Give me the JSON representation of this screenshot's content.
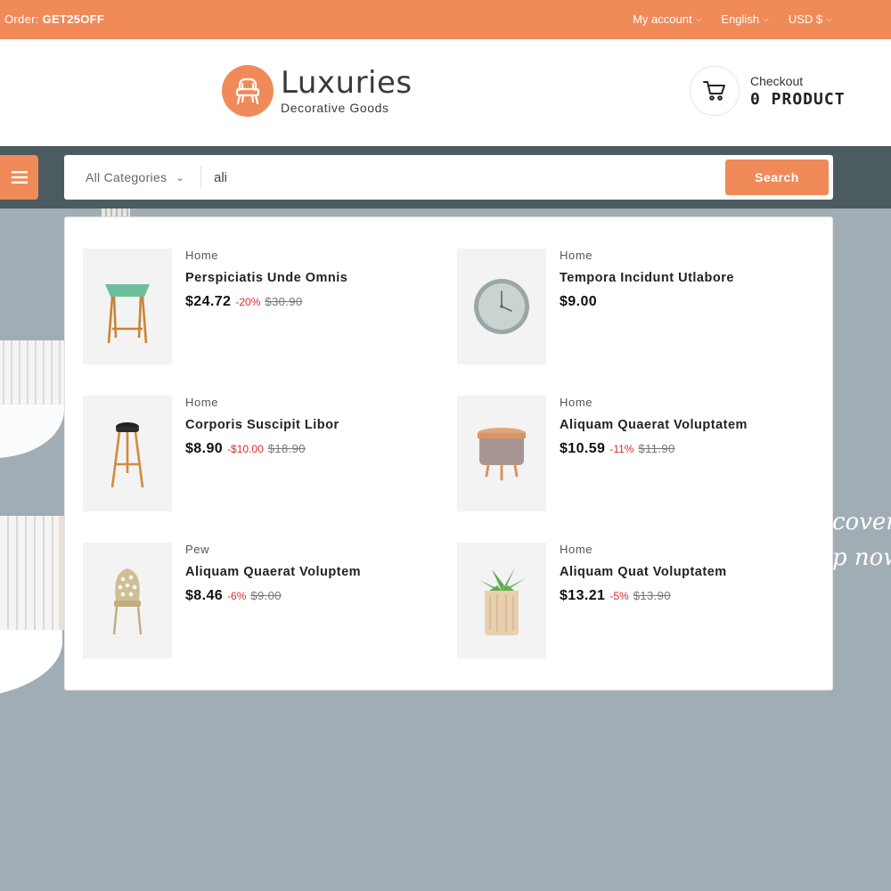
{
  "colors": {
    "accent": "#f08a59",
    "navbar": "#4b5b60",
    "hero_bg": "#a1adb5",
    "discount": "#e02a2a"
  },
  "topbar": {
    "promo_prefix": "Order:",
    "promo_code": "GET25OFF",
    "account_label": "My account",
    "language_label": "English",
    "currency_label": "USD $"
  },
  "logo": {
    "title": "Luxuries",
    "subtitle": "Decorative Goods"
  },
  "cart": {
    "label": "Checkout",
    "count": "0 PRODUCT"
  },
  "search": {
    "category": "All Categories",
    "query": "ali",
    "button_label": "Search"
  },
  "hero": {
    "line1": "cover",
    "line2": "p now"
  },
  "results": [
    {
      "category": "Home",
      "name": "Perspiciatis Unde Omnis",
      "price": "$24.72",
      "discount": "-20%",
      "old_price": "$30.90",
      "icon": "side-table-icon"
    },
    {
      "category": "Home",
      "name": "Tempora Incidunt Utlabore",
      "price": "$9.00",
      "discount": "",
      "old_price": "",
      "icon": "wall-clock-icon"
    },
    {
      "category": "Home",
      "name": "Corporis Suscipit Libor",
      "price": "$8.90",
      "discount": "-$10.00",
      "old_price": "$18.90",
      "icon": "bar-stool-icon"
    },
    {
      "category": "Home",
      "name": "Aliquam Quaerat Voluptatem",
      "price": "$10.59",
      "discount": "-11%",
      "old_price": "$11.90",
      "icon": "ottoman-icon"
    },
    {
      "category": "Pew",
      "name": "Aliquam Quaerat Voluptem",
      "price": "$8.46",
      "discount": "-6%",
      "old_price": "$9.00",
      "icon": "chair-icon"
    },
    {
      "category": "Home",
      "name": "Aliquam Quat Voluptatem",
      "price": "$13.21",
      "discount": "-5%",
      "old_price": "$13.90",
      "icon": "potted-plant-icon"
    }
  ]
}
